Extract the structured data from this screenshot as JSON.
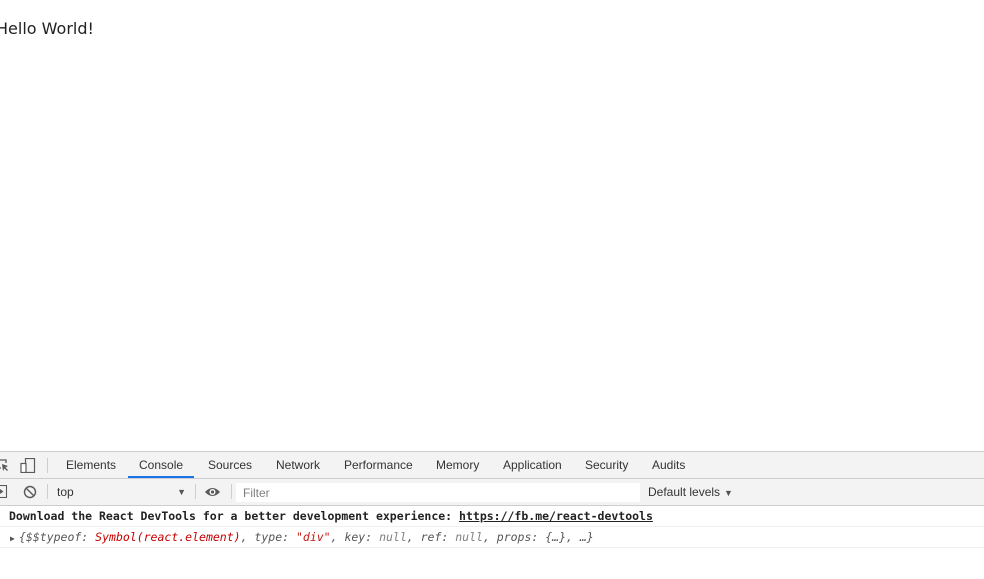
{
  "viewport": {
    "hello_text": "Hello World!"
  },
  "devtools": {
    "tabs": [
      {
        "label": "Elements",
        "active": false
      },
      {
        "label": "Console",
        "active": true
      },
      {
        "label": "Sources",
        "active": false
      },
      {
        "label": "Network",
        "active": false
      },
      {
        "label": "Performance",
        "active": false
      },
      {
        "label": "Memory",
        "active": false
      },
      {
        "label": "Application",
        "active": false
      },
      {
        "label": "Security",
        "active": false
      },
      {
        "label": "Audits",
        "active": false
      }
    ],
    "icons": [
      "inspect-element-icon",
      "device-toolbar-icon",
      "sidebar-toggle-icon",
      "clear-console-icon",
      "eye-icon"
    ],
    "toolbar": {
      "context": "top",
      "filter_placeholder": "Filter",
      "levels_label": "Default levels"
    },
    "accent_color": "#1a73e8",
    "console": {
      "message1_text": "Download the React DevTools for a better development experience: ",
      "message1_link": "https://fb.me/react-devtools",
      "message2": {
        "open": "{$$typeof: ",
        "symbol": "Symbol(react.element)",
        "sep1": ", type: ",
        "type_value": "\"div\"",
        "sep2": ", key: ",
        "key_value": "null",
        "sep3": ", ref: ",
        "ref_value": "null",
        "sep4": ", props: ",
        "rest": "{…}, …}"
      }
    }
  }
}
